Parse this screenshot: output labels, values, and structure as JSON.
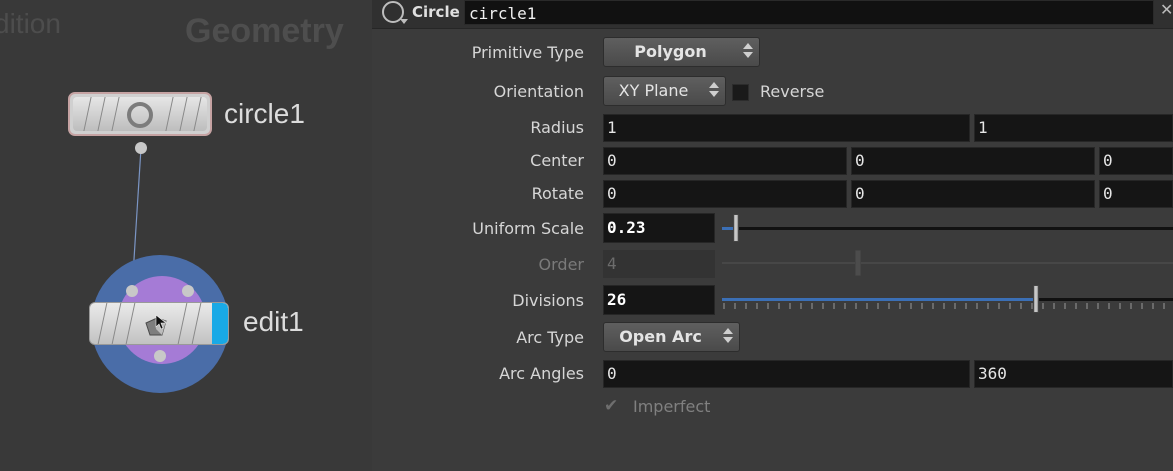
{
  "network": {
    "ghost_left": "dition",
    "ghost_context": "Geometry",
    "nodes": [
      {
        "name": "circle1",
        "icon": "circle-node-icon"
      },
      {
        "name": "edit1",
        "icon": "edit-node-icon"
      }
    ]
  },
  "params": {
    "header": {
      "node_type": "Circle",
      "node_name": "circle1",
      "close_glyph": "✕"
    },
    "primitive_type": {
      "label": "Primitive Type",
      "value": "Polygon"
    },
    "orientation": {
      "label": "Orientation",
      "value": "XY Plane",
      "reverse_label": "Reverse",
      "reverse_checked": false
    },
    "radius": {
      "label": "Radius",
      "values": [
        "1",
        "1"
      ]
    },
    "center": {
      "label": "Center",
      "values": [
        "0",
        "0",
        "0"
      ]
    },
    "rotate": {
      "label": "Rotate",
      "values": [
        "0",
        "0",
        "0"
      ]
    },
    "uniform_scale": {
      "label": "Uniform Scale",
      "value": "0.23"
    },
    "order": {
      "label": "Order",
      "value": "4",
      "enabled": false
    },
    "divisions": {
      "label": "Divisions",
      "value": "26"
    },
    "arc_type": {
      "label": "Arc Type",
      "value": "Open Arc"
    },
    "arc_angles": {
      "label": "Arc Angles",
      "values": [
        "0",
        "360"
      ]
    },
    "imperfect": {
      "label": "Imperfect",
      "checked": true,
      "enabled": false
    }
  },
  "colors": {
    "accent_blue": "#19a9e6",
    "slider_fill": "#3b6fb5",
    "ring_blue": "#4a6da8",
    "ring_purple": "#a57bd6"
  }
}
